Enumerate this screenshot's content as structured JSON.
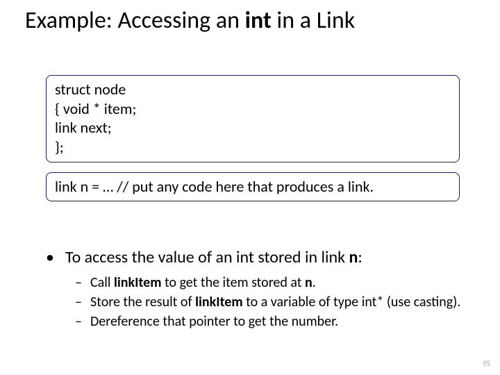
{
  "title": {
    "pre": "Example: Accessing an ",
    "bold": "int",
    "post": " in a Link"
  },
  "code1": {
    "l1": "struct node",
    "l2": "{   void * item;",
    "l3": "     link next;",
    "l4": "};"
  },
  "code2": {
    "l1": "link n = … // put any code here that produces a link."
  },
  "b1": {
    "pre": "To access the value of an int stored in link ",
    "bold": "n",
    "post": ":"
  },
  "s1": {
    "t1": "Call ",
    "b1": "linkItem",
    "t2": " to get the item stored at ",
    "b2": "n",
    "t3": "."
  },
  "s2": {
    "t1": "Store the result of ",
    "b1": "linkItem",
    "t2": " to a variable of type int* (use casting)."
  },
  "s3": {
    "t1": "Dereference that pointer to get the number."
  },
  "page": "95"
}
